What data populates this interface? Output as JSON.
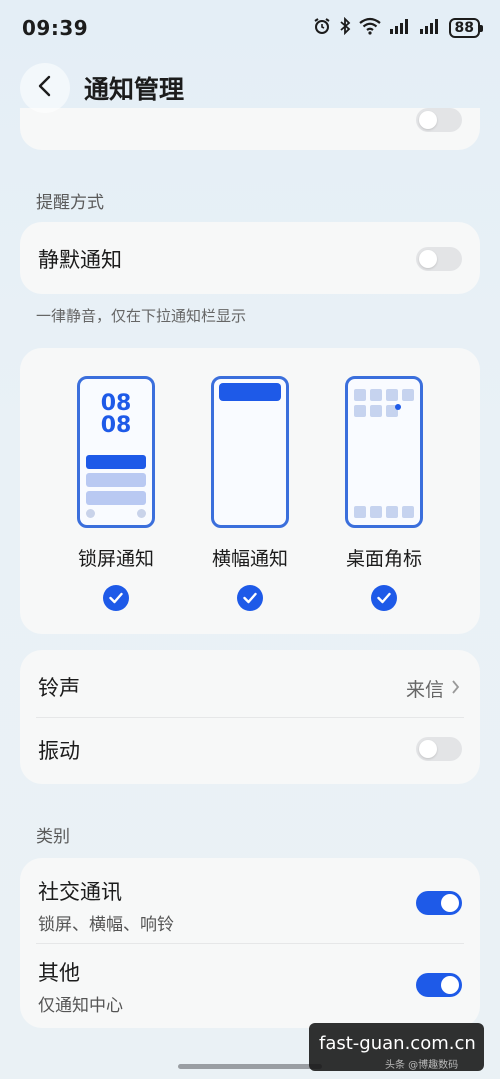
{
  "status_bar": {
    "time": "09:39",
    "battery": "88",
    "icons": [
      "alarm-icon",
      "bluetooth-icon",
      "wifi-icon",
      "signal-icon",
      "signal-icon",
      "battery-icon"
    ]
  },
  "header": {
    "title": "通知管理",
    "back_icon": "chevron-left-icon"
  },
  "reminder_section": {
    "label": "提醒方式",
    "silent": {
      "title": "静默通知",
      "enabled": false
    },
    "silent_hint": "一律静音，仅在下拉通知栏显示"
  },
  "modes": [
    {
      "label": "锁屏通知",
      "clock_top": "08",
      "clock_bottom": "08",
      "checked": true
    },
    {
      "label": "横幅通知",
      "checked": true
    },
    {
      "label": "桌面角标",
      "checked": true
    }
  ],
  "sound": {
    "ringtone": {
      "title": "铃声",
      "value": "来信"
    },
    "vibration": {
      "title": "振动",
      "enabled": false
    }
  },
  "category_section": {
    "label": "类别",
    "items": [
      {
        "title": "社交通讯",
        "subtitle": "锁屏、横幅、响铃",
        "enabled": true
      },
      {
        "title": "其他",
        "subtitle": "仅通知中心",
        "enabled": true
      }
    ]
  },
  "watermark": {
    "main": "fast-guan.com.cn",
    "sub": "头条 @博趣数码"
  },
  "colors": {
    "accent": "#1e5ae8",
    "phone_outline": "#3b6fdc",
    "background": "#e6eff5",
    "card": "#f7f8f8"
  }
}
